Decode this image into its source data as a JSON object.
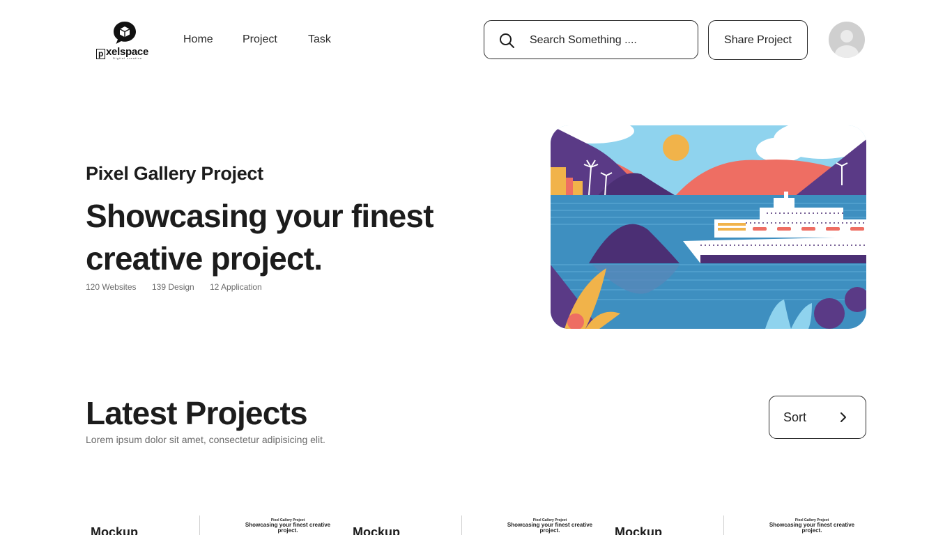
{
  "header": {
    "logo": {
      "wordmark_p": "p",
      "wordmark_rest": "xelspace",
      "tagline": "Digital creative"
    },
    "nav": [
      {
        "label": "Home"
      },
      {
        "label": "Project"
      },
      {
        "label": "Task"
      }
    ],
    "search": {
      "placeholder": "Search Something ...."
    },
    "share_button": "Share Project",
    "icons": {
      "search": "search-icon",
      "avatar": "user-avatar-icon",
      "logo": "chat-bubble-cube-icon"
    }
  },
  "hero": {
    "subtitle": "Pixel Gallery Project",
    "title": "Showcasing your finest creative project.",
    "stats": [
      {
        "label": "120 Websites"
      },
      {
        "label": "139 Design"
      },
      {
        "label": "12 Application"
      }
    ],
    "image": "illustration of cruise ship on bay with mountains",
    "colors": {
      "sky": "#8fd3ee",
      "water": "#3e8fc0",
      "mountain": "#5a3a86",
      "coral": "#ee6e63",
      "sun": "#f1b34a"
    }
  },
  "latest": {
    "title": "Latest Projects",
    "description": "Lorem ipsum dolor sit amet, consectetur adipisicing elit.",
    "sort_button": "Sort",
    "cards": [
      {
        "mockup": "Mockup",
        "mini_sub": "Pixel Gallery Project",
        "mini_title": "Showcasing your finest creative project."
      },
      {
        "mockup": "Mockup",
        "mini_sub": "Pixel Gallery Project",
        "mini_title": "Showcasing your finest creative project."
      },
      {
        "mockup": "Mockup",
        "mini_sub": "Pixel Gallery Project",
        "mini_title": "Showcasing your finest creative project."
      }
    ]
  }
}
